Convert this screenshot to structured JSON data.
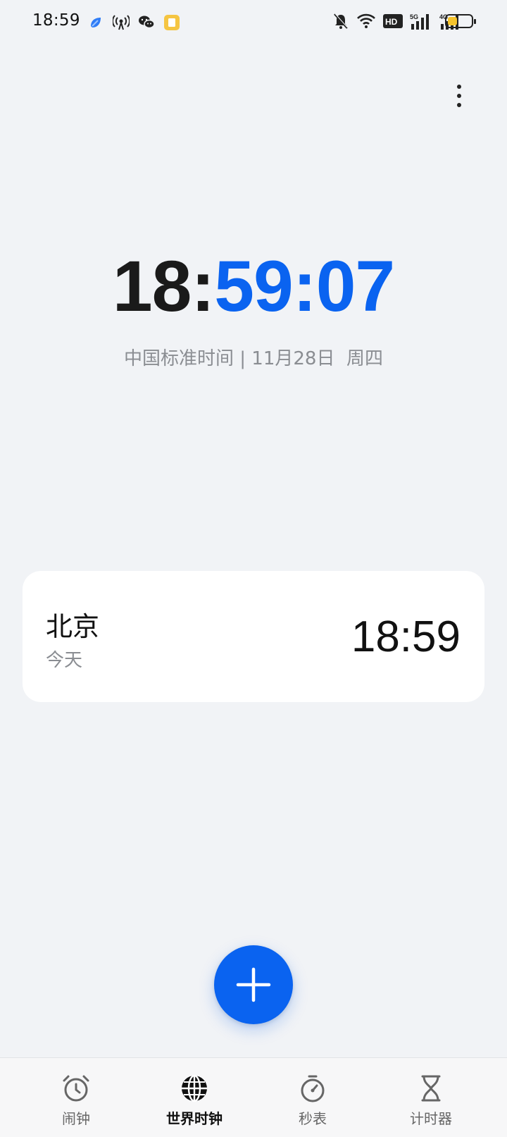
{
  "status_bar": {
    "time": "18:59",
    "left_icons": [
      "app-icon-blue",
      "hotspot-icon",
      "wechat-icon",
      "notes-app-icon"
    ],
    "right_icons": [
      "mute-bell-icon",
      "wifi-icon",
      "hd-icon",
      "signal-5g-icon",
      "signal-4g-icon"
    ],
    "battery_level": 0.4,
    "hd_text": "HD",
    "signal_5g": "5G",
    "signal_4g": "4G"
  },
  "main_clock": {
    "hours": "18:",
    "rest": "59:07",
    "subtitle": "中国标准时间 | 11月28日  周四"
  },
  "city_card": {
    "name": "北京",
    "day": "今天",
    "time": "18:59"
  },
  "fab": {
    "icon": "plus-icon"
  },
  "bottom_nav": {
    "items": [
      {
        "label": "闹钟",
        "icon": "alarm-clock-icon",
        "active": false
      },
      {
        "label": "世界时钟",
        "icon": "globe-icon",
        "active": true
      },
      {
        "label": "秒表",
        "icon": "stopwatch-icon",
        "active": false
      },
      {
        "label": "计时器",
        "icon": "hourglass-icon",
        "active": false
      }
    ]
  },
  "colors": {
    "accent": "#0a63f0",
    "background": "#f1f3f6",
    "battery": "#f5c32c"
  }
}
